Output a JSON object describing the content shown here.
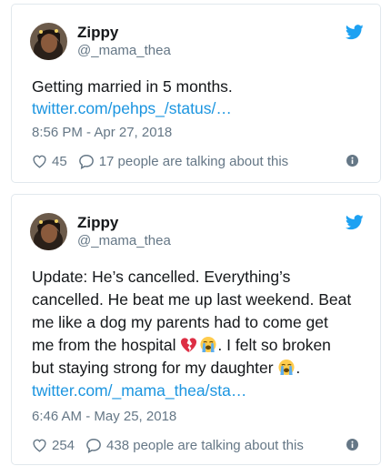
{
  "tweets": [
    {
      "name": "Zippy",
      "handle": "@_mama_thea",
      "text": "Getting married in 5 months.",
      "link": "twitter.com/pehps_/status/…",
      "timestamp": "8:56 PM - Apr 27, 2018",
      "likes": "45",
      "talking": "17 people are talking about this"
    },
    {
      "name": "Zippy",
      "handle": "@_mama_thea",
      "text_line1": "Update: He’s cancelled. Everything’s",
      "text_line2": "cancelled. He beat me up last weekend. Beat",
      "text_line3": "me like a dog my parents had to come get",
      "text_line4_a": "me from the hospital ",
      "text_line4_b": ". I felt so broken",
      "text_line5_a": "but staying strong for my daughter ",
      "text_line5_b": ".",
      "link": "twitter.com/_mama_thea/sta…",
      "timestamp": "6:46 AM - May 25, 2018",
      "likes": "254",
      "talking": "438 people are talking about this"
    }
  ],
  "icons": {
    "bird": "twitter-bird-icon",
    "heart": "heart-outline-icon",
    "reply": "reply-bubble-icon",
    "info": "info-icon",
    "broken_heart": "broken-heart-emoji",
    "crying_face": "loudly-crying-face-emoji"
  },
  "colors": {
    "twitter_blue": "#1da1f2",
    "link": "#1b95e0",
    "secondary_text": "#657786",
    "card_border": "#e1e8ed"
  }
}
